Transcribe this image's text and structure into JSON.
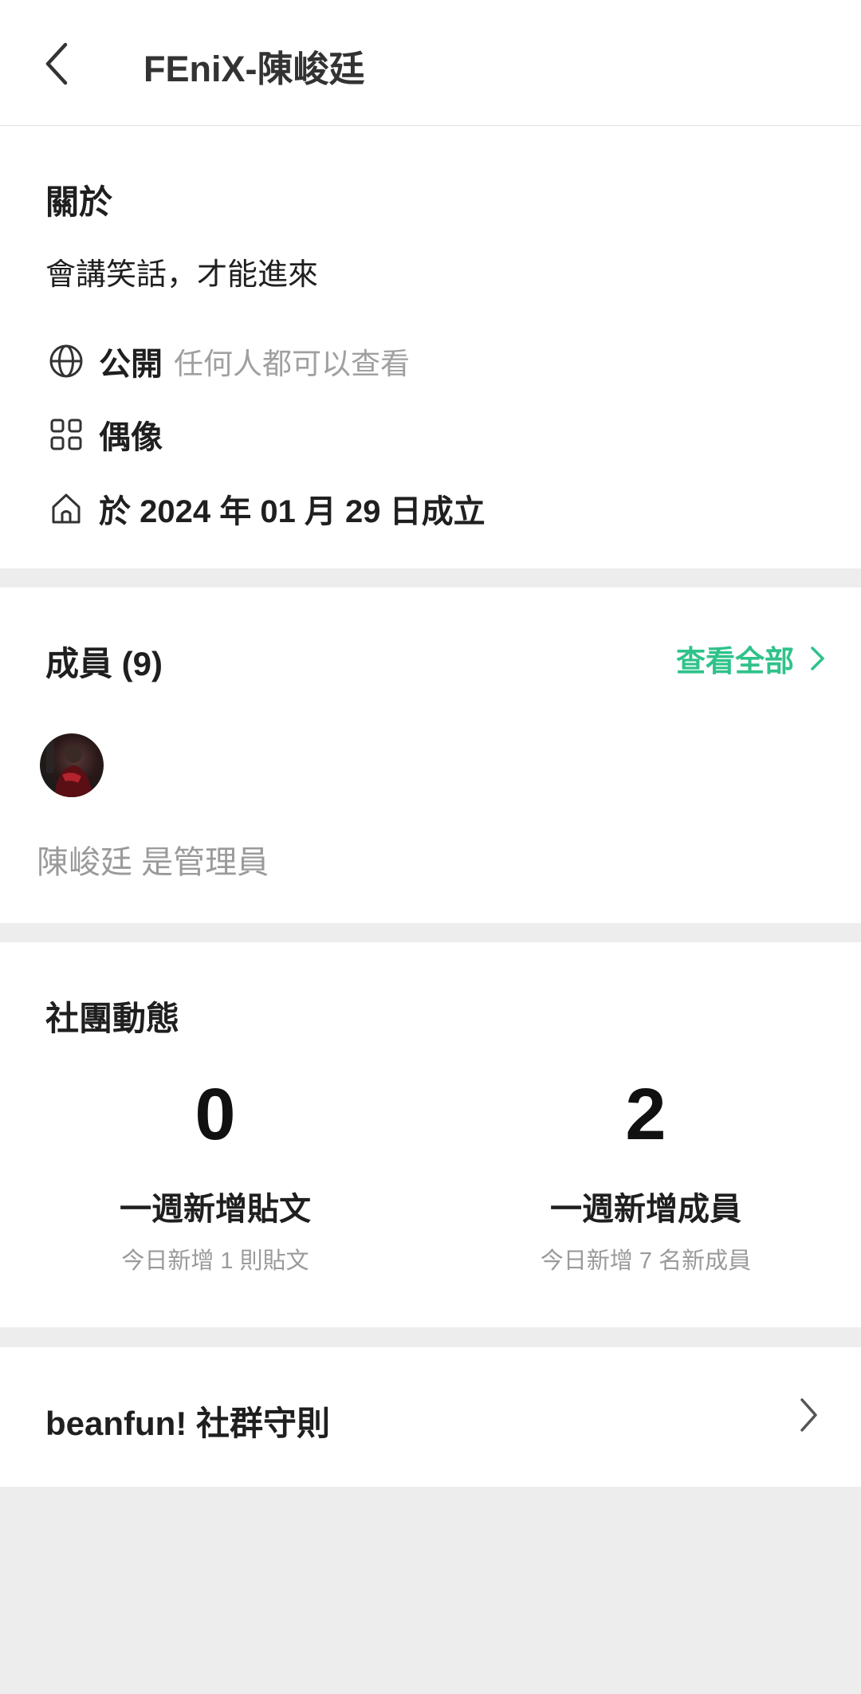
{
  "header": {
    "title": "FEniX-陳峻廷"
  },
  "about": {
    "title": "關於",
    "description": "會講笑話，才能進來",
    "privacy_label": "公開",
    "privacy_sub": "任何人都可以查看",
    "category": "偶像",
    "founded": "於 2024 年 01 月 29 日成立"
  },
  "members": {
    "title": "成員 (9)",
    "see_all": "查看全部",
    "admin_note": "陳峻廷 是管理員"
  },
  "activity": {
    "title": "社團動態",
    "stats": [
      {
        "value": "0",
        "label": "一週新增貼文",
        "sub": "今日新增 1 則貼文"
      },
      {
        "value": "2",
        "label": "一週新增成員",
        "sub": "今日新增 7 名新成員"
      }
    ]
  },
  "rules": {
    "label": "beanfun! 社群守則"
  },
  "colors": {
    "accent": "#2fc28a",
    "muted": "#9a9a9a",
    "background": "#ededed"
  },
  "icons": [
    "back-icon",
    "globe-icon",
    "grid-icon",
    "home-icon",
    "chevron-right-icon"
  ]
}
